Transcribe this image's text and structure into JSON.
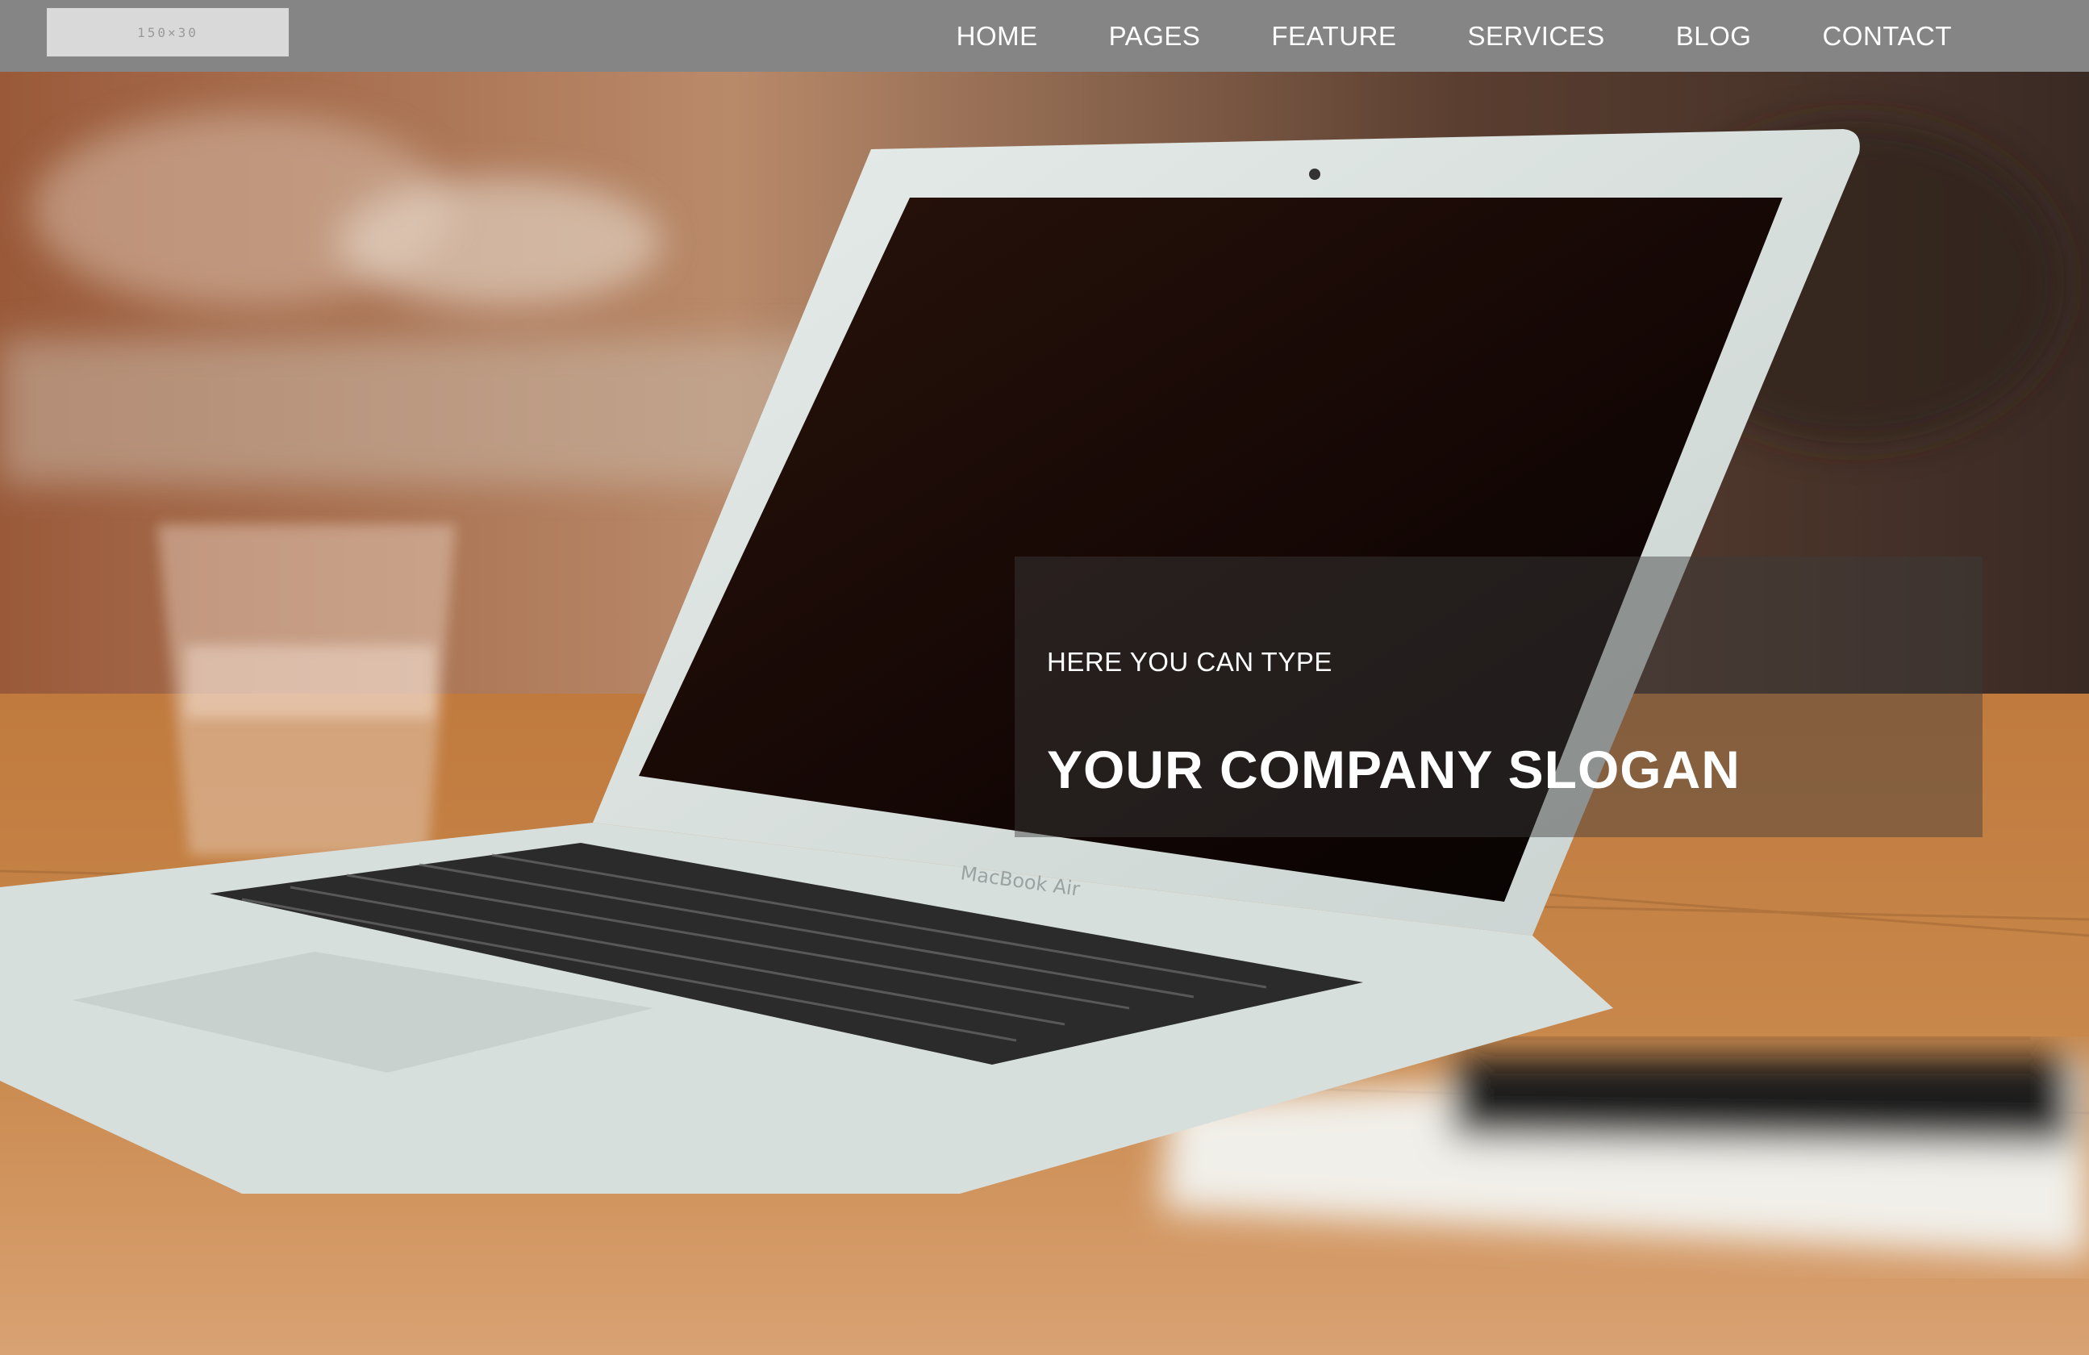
{
  "header": {
    "logo_text": "150×30",
    "nav": [
      {
        "label": "HOME"
      },
      {
        "label": "PAGES"
      },
      {
        "label": "FEATURE"
      },
      {
        "label": "SERVICES"
      },
      {
        "label": "BLOG"
      },
      {
        "label": "CONTACT"
      }
    ]
  },
  "hero": {
    "subtitle": "HERE YOU CAN TYPE",
    "title": "YOUR COMPANY SLOGAN",
    "laptop_label": "MacBook Air"
  },
  "colors": {
    "navbar_bg": "#858585",
    "overlay_bg": "rgba(60,60,60,0.45)",
    "text": "#ffffff"
  }
}
